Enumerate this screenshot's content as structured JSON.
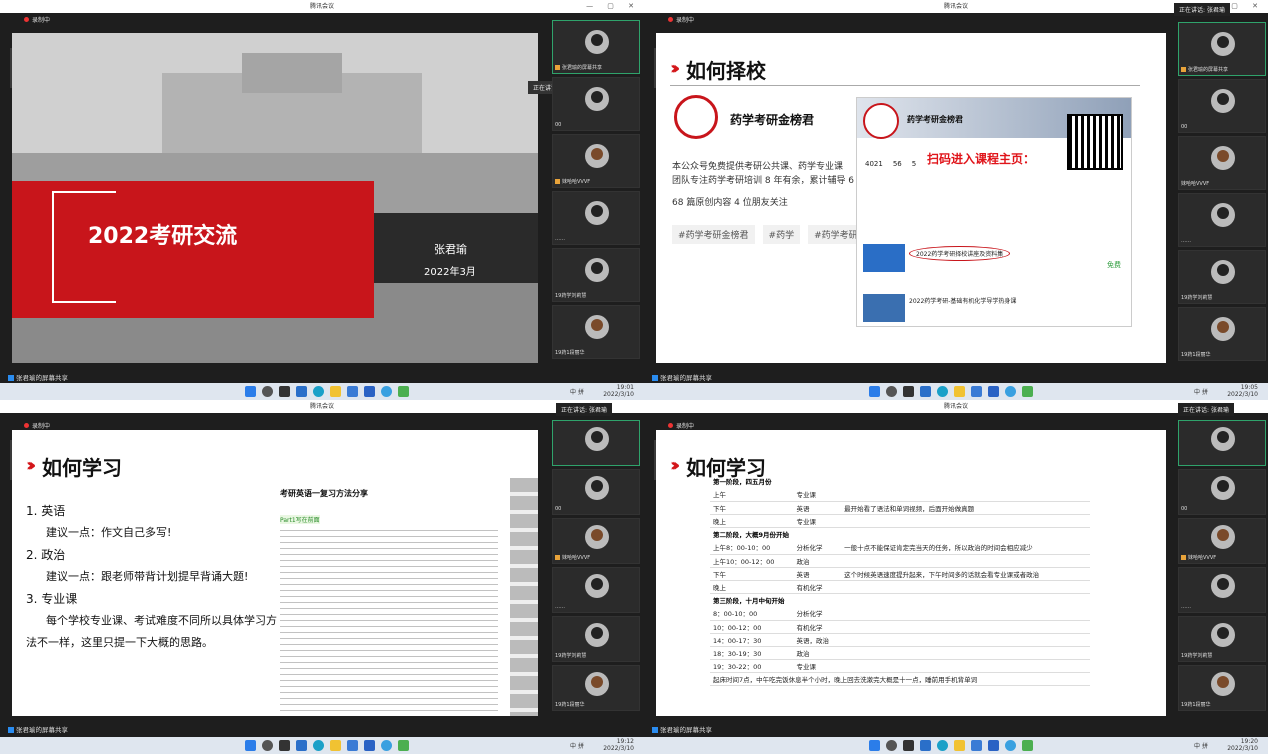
{
  "app_title": "腾讯会议",
  "recording": "录制中",
  "speaking_prefix": "正在讲话: ",
  "speaker": "张君瑜",
  "share_label": "张君瑜的屏幕共享",
  "tray": {
    "lang": "中",
    "ime": "拼"
  },
  "times": [
    {
      "time": "19:01",
      "date": "2022/3/10"
    },
    {
      "time": "19:05",
      "date": "2022/3/10"
    },
    {
      "time": "19:12",
      "date": "2022/3/10"
    },
    {
      "time": "19:20",
      "date": "2022/3/10"
    }
  ],
  "participants": [
    "张君瑜的屏幕共享",
    "00",
    "妹哈哈VVVF",
    "……",
    "19药学刘莉慧",
    "19药1段丽华"
  ],
  "slide1": {
    "title": "2022考研交流",
    "presenter": "张君瑜",
    "date": "2022年3月"
  },
  "slide2": {
    "heading": "如何择校",
    "account": "药学考研金榜君",
    "desc1": "本公众号免费提供考研公共课、药学专业课",
    "desc2": "团队专注药学考研培训 8 年有余，累计辅导 6",
    "desc3": "68 篇原创内容  4 位朋友关注",
    "tags": [
      "#药学考研金榜君",
      "#药学",
      "#药学考研"
    ],
    "scan_text": "扫码进入课程主页：",
    "stats": [
      "4021",
      "56",
      "5"
    ],
    "courses": [
      "2022药学考研择校讲座及资料集",
      "2022药学考研-基础有机化学导学热身课"
    ],
    "free": "免费"
  },
  "slide3": {
    "heading": "如何学习",
    "items": [
      {
        "num": "1.",
        "title": "英语",
        "detail": "建议一点：作文自己多写!"
      },
      {
        "num": "2.",
        "title": "政治",
        "detail": "建议一点：跟老师带背计划提早背诵大题!"
      },
      {
        "num": "3.",
        "title": "专业课",
        "detail": "每个学校专业课、考试难度不同所以具体学习方法不一样，这里只提一下大概的思路。"
      }
    ],
    "doc_title": "考研英语一复习方法分享",
    "doc_part": "Part1写在前面"
  },
  "slide4": {
    "heading": "如何学习",
    "stage1": "第一阶段，四五月份",
    "rows1": [
      [
        "上午",
        "专业课",
        ""
      ],
      [
        "下午",
        "英语",
        "最开始看了语法和单词视频，后面开始做真题"
      ],
      [
        "晚上",
        "专业课",
        ""
      ]
    ],
    "stage2": "第二阶段，大概9月份开始",
    "rows2": [
      [
        "上午8：00-10：00",
        "分析化学",
        "一般十点不能保证肯定完当天的任务，所以政治的时间会相应减少"
      ],
      [
        "上午10：00-12：00",
        "政治",
        ""
      ],
      [
        "下午",
        "英语",
        "这个时候英语速度提升起来，下午时间多的话就会看专业课或者政治"
      ],
      [
        "晚上",
        "有机化学",
        ""
      ]
    ],
    "stage3": "第三阶段，十月中旬开始",
    "rows3": [
      [
        "8：00-10：00",
        "分析化学",
        ""
      ],
      [
        "10：00-12：00",
        "有机化学",
        ""
      ],
      [
        "14：00-17：30",
        "英语，政治",
        ""
      ],
      [
        "18：30-19：30",
        "政治",
        ""
      ],
      [
        "19：30-22：00",
        "专业课",
        ""
      ]
    ],
    "footer": "起床时间7点，中午吃完饭休息半个小时，晚上回去洗漱完大概是十一点，睡前用手机背单词"
  }
}
